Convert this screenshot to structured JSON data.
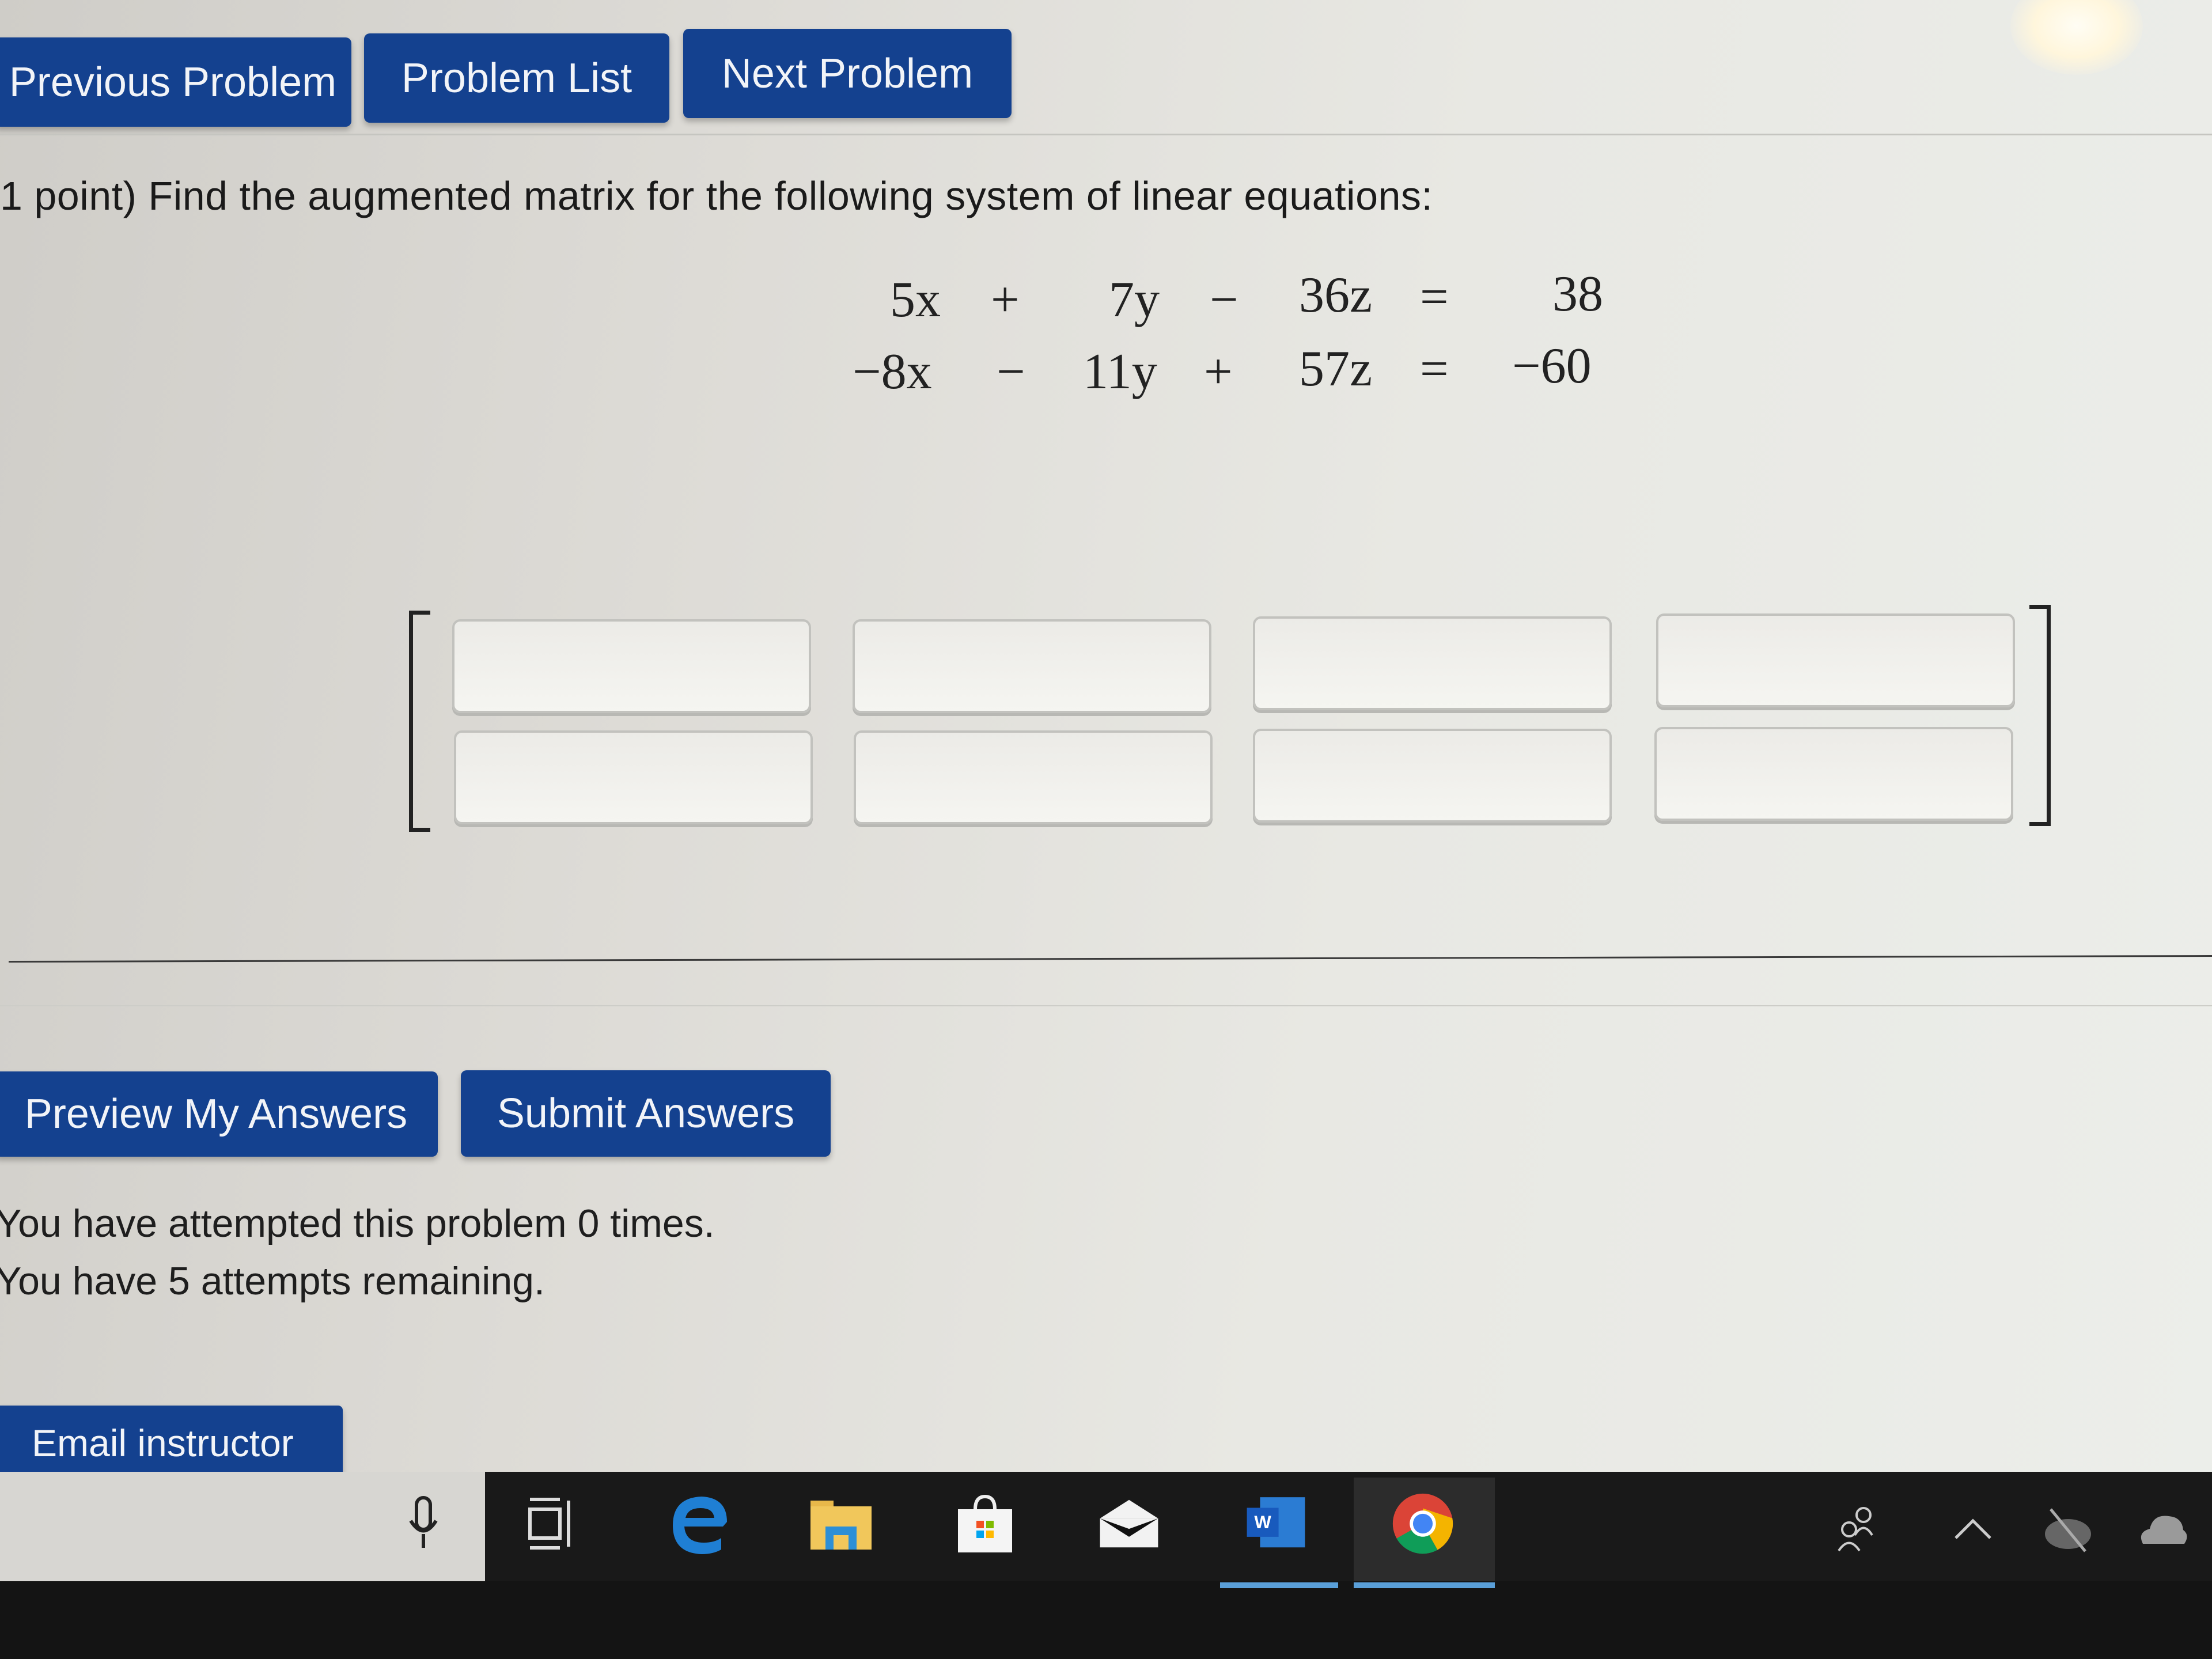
{
  "nav": {
    "previous_label": "Previous Problem",
    "list_label": "Problem List",
    "next_label": "Next Problem"
  },
  "problem": {
    "prompt": "1 point) Find the augmented matrix for the following system of linear equations:",
    "equations": [
      {
        "t1": "5x",
        "op1": "+",
        "t2": "7y",
        "op2": "−",
        "t3": "36z",
        "eq": "=",
        "rhs": "38"
      },
      {
        "t1": "−8x",
        "op1": "−",
        "t2": "11y",
        "op2": "+",
        "t3": "57z",
        "eq": "=",
        "rhs": "−60"
      }
    ],
    "matrix": {
      "rows": 2,
      "cols": 4,
      "values": [
        [
          "",
          "",
          "",
          ""
        ],
        [
          "",
          "",
          "",
          ""
        ]
      ],
      "palette_icon": "grid-icon"
    }
  },
  "actions": {
    "preview_label": "Preview My Answers",
    "submit_label": "Submit Answers"
  },
  "status": {
    "attempted": "You have attempted this problem 0 times.",
    "remaining": "You have 5 attempts remaining."
  },
  "footer": {
    "email_label": "Email instructor"
  },
  "taskbar": {
    "icons": [
      "microphone-icon",
      "task-view-icon",
      "edge-icon",
      "file-explorer-icon",
      "store-icon",
      "mail-icon",
      "word-icon",
      "chrome-icon"
    ],
    "tray": [
      "people-icon",
      "chevron-up-icon",
      "network-off-icon",
      "onedrive-icon"
    ],
    "word_label": "W"
  },
  "colors": {
    "button_blue": "#14418f",
    "taskbar": "#191919",
    "active_indicator": "#5a9fd8"
  }
}
